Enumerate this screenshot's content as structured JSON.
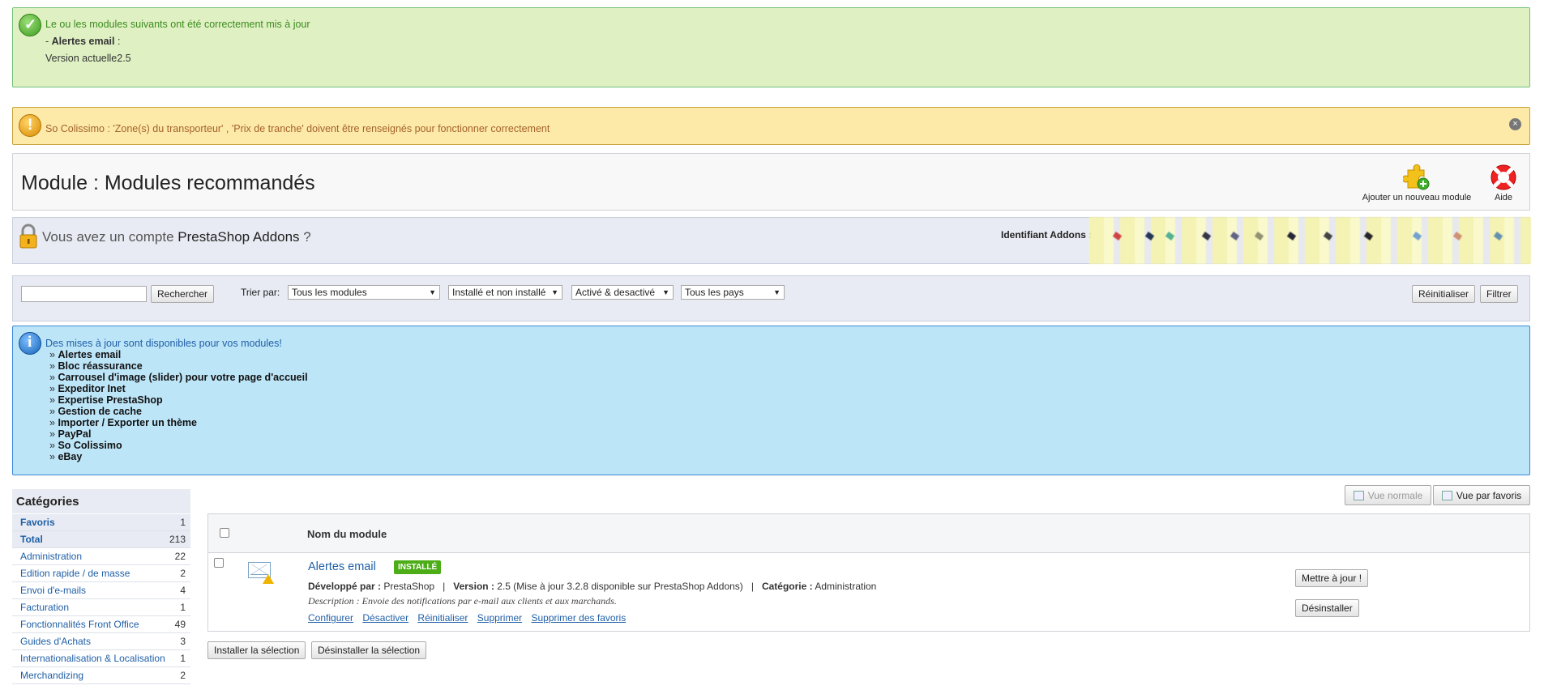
{
  "success": {
    "line1": "Le ou les modules suivants ont été correctement mis à jour",
    "line2_prefix": "- ",
    "line2_bold": "Alertes email",
    "line2_suffix": " :",
    "line3": "Version actuelle2.5"
  },
  "warning": {
    "text": "So Colissimo : 'Zone(s) du transporteur' , 'Prix de tranche' doivent être renseignés pour fonctionner correctement"
  },
  "header": {
    "title": "Module : Modules recommandés",
    "add_module_label": "Ajouter un nouveau module",
    "help_label": "Aide"
  },
  "addons": {
    "text_prefix": "Vous avez un compte ",
    "text_brand": "PrestaShop Addons",
    "text_suffix": " ?",
    "ident_label": "Identifiant Addons :"
  },
  "filter": {
    "search_button": "Rechercher",
    "sort_label": "Trier par:",
    "select1": "Tous les modules",
    "select2": "Installé et non installé",
    "select3": "Activé & desactivé",
    "select4": "Tous les pays",
    "reset_button": "Réinitialiser",
    "filter_button": "Filtrer"
  },
  "info": {
    "head": "Des mises à jour sont disponibles pour vos modules!",
    "items": [
      "Alertes email",
      "Bloc réassurance",
      "Carrousel d'image (slider) pour votre page d'accueil",
      "Expeditor Inet",
      "Expertise PrestaShop",
      "Gestion de cache",
      "Importer / Exporter un thème",
      "PayPal",
      "So Colissimo",
      "eBay"
    ]
  },
  "categories": {
    "title": "Catégories",
    "rows": [
      {
        "name": "Favoris",
        "count": "1"
      },
      {
        "name": "Total",
        "count": "213"
      },
      {
        "name": "Administration",
        "count": "22"
      },
      {
        "name": "Edition rapide / de masse",
        "count": "2"
      },
      {
        "name": "Envoi d'e-mails",
        "count": "4"
      },
      {
        "name": "Facturation",
        "count": "1"
      },
      {
        "name": "Fonctionnalités Front Office",
        "count": "49"
      },
      {
        "name": "Guides d'Achats",
        "count": "3"
      },
      {
        "name": "Internationalisation & Localisation",
        "count": "1"
      },
      {
        "name": "Merchandizing",
        "count": "2"
      }
    ]
  },
  "view": {
    "normal": "Vue normale",
    "favorites": "Vue par favoris"
  },
  "table": {
    "column_header": "Nom du module",
    "module": {
      "name": "Alertes email",
      "badge": "INSTALLÉ",
      "dev_label": "Développé par :",
      "dev_value": "PrestaShop",
      "sep": "|",
      "version_label": "Version :",
      "version_value": "2.5 (Mise à jour 3.2.8 disponible sur PrestaShop Addons)",
      "category_label": "Catégorie :",
      "category_value": "Administration",
      "description": "Description : Envoie des notifications par e-mail aux clients et aux marchands.",
      "links": [
        "Configurer",
        "Désactiver",
        "Réinitialiser",
        "Supprimer",
        "Supprimer des favoris"
      ],
      "update_button": "Mettre à jour !",
      "uninstall_button": "Désinstaller"
    }
  },
  "bulk": {
    "install": "Installer la sélection",
    "uninstall": "Désinstaller la sélection"
  }
}
